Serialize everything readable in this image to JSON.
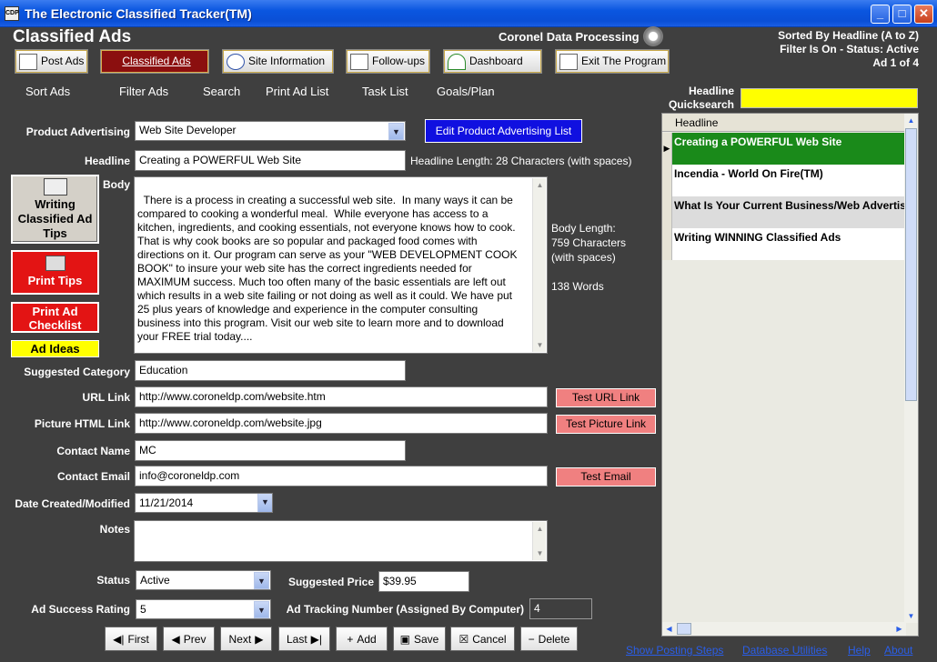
{
  "window": {
    "title": "The Electronic Classified Tracker(TM)",
    "icon_label": "CDP"
  },
  "header": {
    "title": "Classified Ads",
    "company": "Coronel Data Processing",
    "sort_status": "Sorted By Headline (A to Z)",
    "filter_status": "Filter Is On - Status: Active",
    "record_status": "Ad 1 of 4"
  },
  "nav": {
    "post_ads": "Post Ads",
    "classified_ads": "Classified Ads",
    "site_information": "Site Information",
    "follow_ups": "Follow-ups",
    "dashboard": "Dashboard",
    "exit": "Exit The Program"
  },
  "menu": [
    "Sort Ads",
    "Filter Ads",
    "Search",
    "Print Ad List",
    "Task List",
    "Goals/Plan"
  ],
  "quicksearch": {
    "label_line1": "Headline",
    "label_line2": "Quicksearch",
    "value": ""
  },
  "form": {
    "product_label": "Product  Advertising",
    "product_value": "Web Site Developer",
    "edit_product_button": "Edit Product Advertising List",
    "headline_label": "Headline",
    "headline_value": "Creating a POWERFUL Web Site",
    "headline_length": "Headline Length: 28 Characters (with spaces)",
    "body_label": "Body",
    "body_value": "There is a process in creating a successful web site.  In many ways it can be\ncompared to cooking a wonderful meal.  While everyone has access to a\nkitchen, ingredients, and cooking essentials, not everyone knows how to cook.\nThat is why cook books are so popular and packaged food comes with\ndirections on it. Our program can serve as your \"WEB DEVELOPMENT COOK\nBOOK\" to insure your web site has the correct ingredients needed for\nMAXIMUM success. Much too often many of the basic essentials are left out\nwhich results in a web site failing or not doing as well as it could. We have put\n25 plus years of knowledge and experience in the computer consulting\nbusiness into this program. Visit our web site to learn more and to download\nyour FREE trial today....",
    "body_length_1": "Body Length:",
    "body_length_2": "759 Characters",
    "body_length_3": "(with spaces)",
    "word_count": "138 Words",
    "category_label": "Suggested Category",
    "category_value": "Education",
    "url_label": "URL Link",
    "url_value": "http://www.coroneldp.com/website.htm",
    "test_url": "Test URL Link",
    "picture_label": "Picture HTML Link",
    "picture_value": "http://www.coroneldp.com/website.jpg",
    "test_picture": "Test Picture Link",
    "contact_name_label": "Contact Name",
    "contact_name_value": "MC",
    "contact_email_label": "Contact Email",
    "contact_email_value": "info@coroneldp.com",
    "test_email": "Test Email",
    "date_label": "Date Created/Modified",
    "date_value": "11/21/2014",
    "notes_label": "Notes",
    "notes_value": "",
    "status_label": "Status",
    "status_value": "Active",
    "price_label": "Suggested Price",
    "price_value": "$39.95",
    "rating_label": "Ad Success Rating",
    "rating_value": "5",
    "tracking_label": "Ad Tracking Number (Assigned By Computer)",
    "tracking_value": "4"
  },
  "side": {
    "tips_line1": "Writing",
    "tips_line2": "Classified Ad",
    "tips_line3": "Tips",
    "print_tips": "Print Tips",
    "print_checklist_1": "Print Ad",
    "print_checklist_2": "Checklist",
    "ad_ideas": "Ad Ideas"
  },
  "list": {
    "header": "Headline",
    "rows": [
      "Creating a POWERFUL Web Site",
      "Incendia - World On Fire(TM)",
      "What Is Your Current Business/Web Advertis",
      "Writing WINNING Classified Ads"
    ]
  },
  "records": {
    "first": "First",
    "prev": "Prev",
    "next": "Next",
    "last": "Last",
    "add": "Add",
    "save": "Save",
    "cancel": "Cancel",
    "delete": "Delete"
  },
  "footer": {
    "posting_steps": "Show Posting Steps",
    "db_utilities": "Database Utilities",
    "help": "Help",
    "about": "About"
  },
  "colors": {
    "accent_red": "#e31414",
    "selected_row": "#1a8a1a",
    "quicksearch_bg": "#ffff00",
    "edit_button_bg": "#1010e0"
  }
}
